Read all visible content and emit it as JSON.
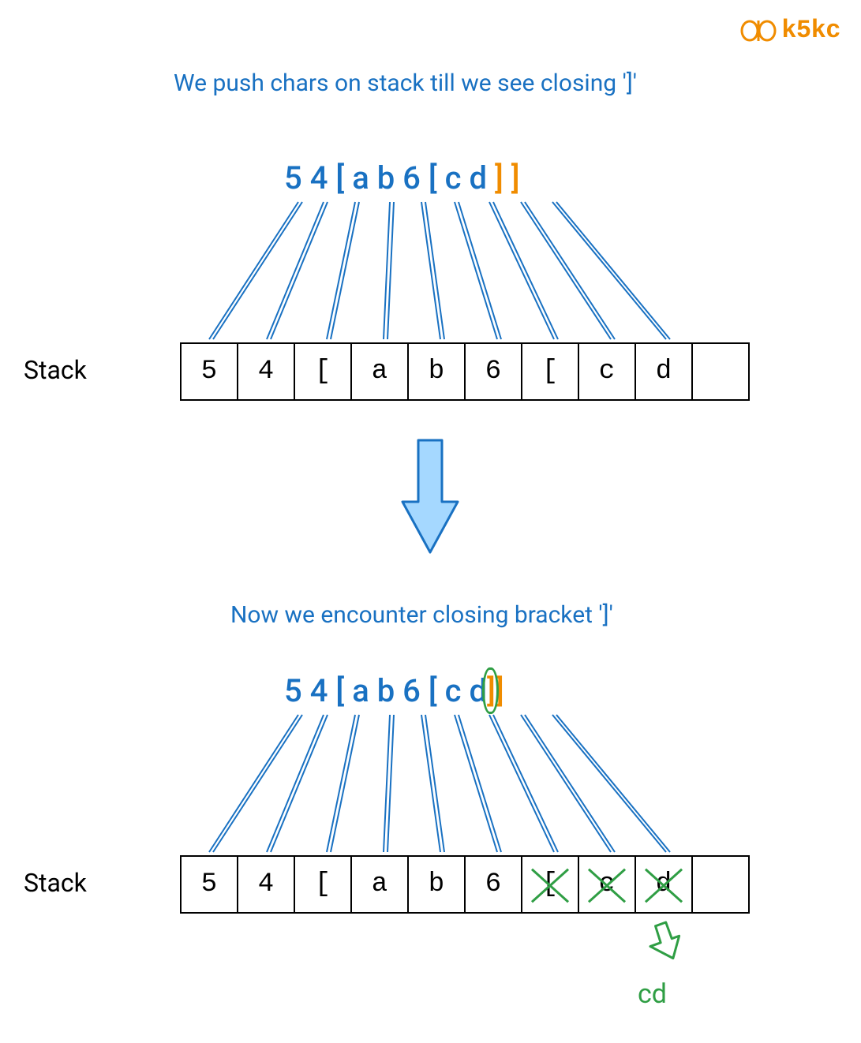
{
  "logo": {
    "text": "k5kc"
  },
  "colors": {
    "blue": "#1971c2",
    "orange": "#f08c00",
    "green": "#2f9e44"
  },
  "step1": {
    "title": "We push chars on stack till we see closing ']'",
    "sequence": {
      "tokens": [
        {
          "text": "5",
          "style": "blue"
        },
        {
          "text": " ",
          "style": "blue"
        },
        {
          "text": "4",
          "style": "blue"
        },
        {
          "text": " ",
          "style": "blue"
        },
        {
          "text": "[",
          "style": "blue"
        },
        {
          "text": " ",
          "style": "blue"
        },
        {
          "text": "a",
          "style": "blue"
        },
        {
          "text": " ",
          "style": "blue"
        },
        {
          "text": "b",
          "style": "blue"
        },
        {
          "text": " ",
          "style": "blue"
        },
        {
          "text": "6",
          "style": "blue"
        },
        {
          "text": " ",
          "style": "blue"
        },
        {
          "text": "[",
          "style": "blue"
        },
        {
          "text": " ",
          "style": "blue"
        },
        {
          "text": "c",
          "style": "blue"
        },
        {
          "text": " ",
          "style": "blue"
        },
        {
          "text": "d",
          "style": "blue"
        },
        {
          "text": " ",
          "style": "blue"
        },
        {
          "text": "]",
          "style": "orange"
        },
        {
          "text": " ",
          "style": "orange"
        },
        {
          "text": "]",
          "style": "orange"
        }
      ]
    },
    "stack_label": "Stack",
    "stack": [
      "5",
      "4",
      "[",
      "a",
      "b",
      "6",
      "[",
      "c",
      "d",
      ""
    ],
    "crossed": []
  },
  "step2": {
    "title": "Now we encounter closing bracket ']'",
    "sequence": {
      "tokens": [
        {
          "text": "5",
          "style": "blue"
        },
        {
          "text": " ",
          "style": "blue"
        },
        {
          "text": "4",
          "style": "blue"
        },
        {
          "text": " ",
          "style": "blue"
        },
        {
          "text": "[",
          "style": "blue"
        },
        {
          "text": " ",
          "style": "blue"
        },
        {
          "text": "a",
          "style": "blue"
        },
        {
          "text": " ",
          "style": "blue"
        },
        {
          "text": "b",
          "style": "blue"
        },
        {
          "text": " ",
          "style": "blue"
        },
        {
          "text": "6",
          "style": "blue"
        },
        {
          "text": " ",
          "style": "blue"
        },
        {
          "text": "[",
          "style": "blue"
        },
        {
          "text": " ",
          "style": "blue"
        },
        {
          "text": "c",
          "style": "blue"
        },
        {
          "text": " ",
          "style": "blue"
        },
        {
          "text": "d",
          "style": "blue"
        },
        {
          "text": "",
          "style": "blue"
        },
        {
          "text": "]",
          "style": "orange-circled"
        },
        {
          "text": "",
          "style": "orange"
        },
        {
          "text": "]",
          "style": "orange"
        }
      ]
    },
    "stack_label": "Stack",
    "stack": [
      "5",
      "4",
      "[",
      "a",
      "b",
      "6",
      "[",
      "c",
      "d",
      ""
    ],
    "crossed": [
      6,
      7,
      8
    ],
    "result": "cd"
  }
}
